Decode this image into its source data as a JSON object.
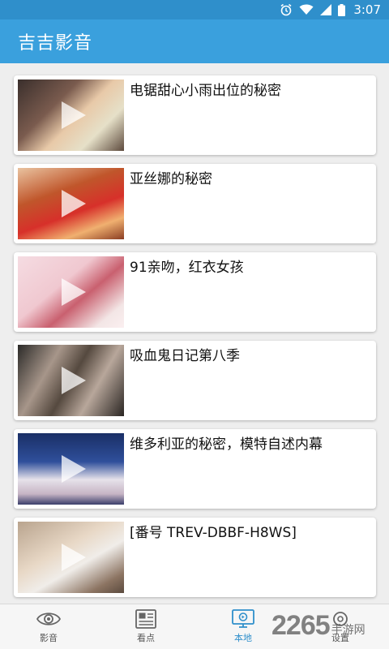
{
  "status_bar": {
    "time": "3:07",
    "icons": [
      "alarm-icon",
      "wifi-icon",
      "signal-icon",
      "battery-icon"
    ]
  },
  "app": {
    "title": "吉吉影音",
    "accent": "#3aa0dd"
  },
  "videos": [
    {
      "title": "电锯甜心小雨出位的秘密"
    },
    {
      "title": "亚丝娜的秘密"
    },
    {
      "title": "91亲吻，红衣女孩"
    },
    {
      "title": "吸血鬼日记第八季"
    },
    {
      "title": "维多利亚的秘密，模特自述内幕"
    },
    {
      "title": "[番号 TREV-DBBF-H8WS]"
    }
  ],
  "bottom_nav": {
    "items": [
      {
        "label": "影音",
        "icon": "eye-icon",
        "active": false
      },
      {
        "label": "看点",
        "icon": "news-icon",
        "active": false
      },
      {
        "label": "本地",
        "icon": "local-video-icon",
        "active": true
      },
      {
        "label": "设置",
        "icon": "settings-icon",
        "active": false
      }
    ]
  },
  "watermark": {
    "number": "2265",
    "text": "手游网"
  }
}
